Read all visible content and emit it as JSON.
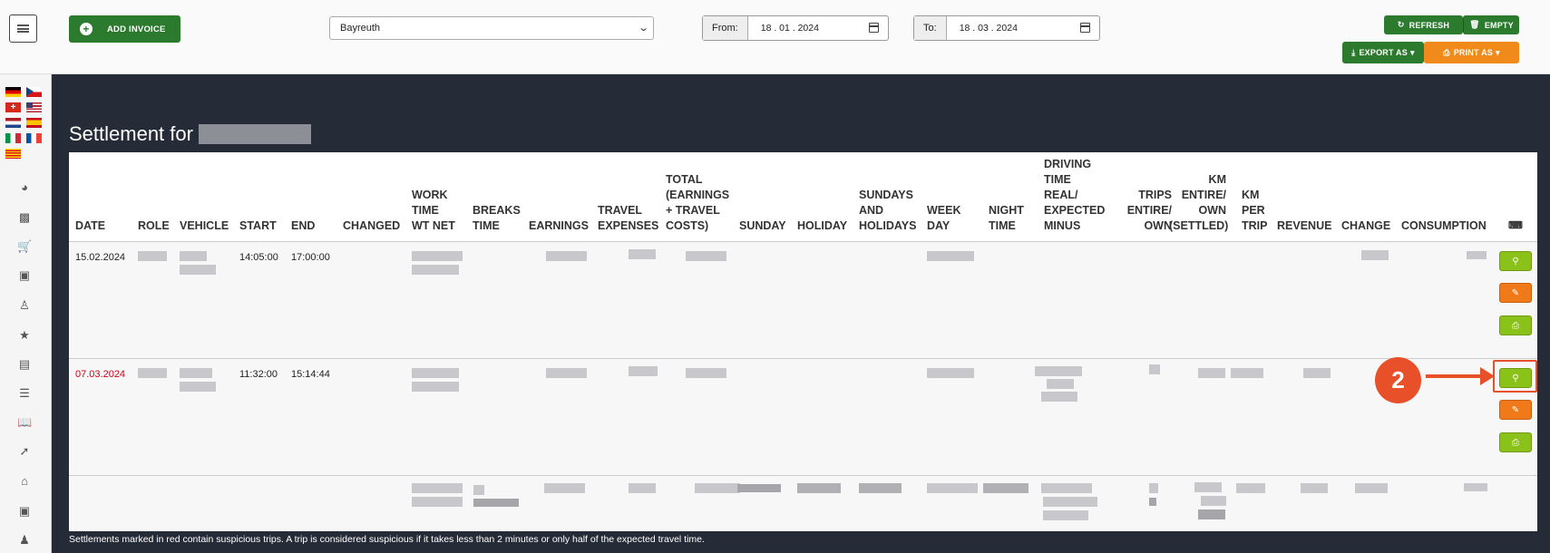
{
  "toolbar": {
    "add_invoice": "ADD INVOICE",
    "location": "Bayreuth",
    "from_label": "From:",
    "from_value": "18 . 01 . 2024",
    "to_label": "To:",
    "to_value": "18 . 03 . 2024",
    "refresh": "REFRESH",
    "empty": "EMPTY",
    "export_as": "EXPORT AS",
    "print_as": "PRINT AS"
  },
  "page": {
    "title": "Settlement for",
    "footer_note": "Settlements marked in red contain suspicious trips. A trip is considered suspicious if it takes less than 2 minutes or only half of the expected travel time."
  },
  "table": {
    "headers": {
      "date": "DATE",
      "role": "ROLE",
      "vehicle": "VEHICLE",
      "start": "START",
      "end": "END",
      "changed": "CHANGED",
      "work_time": "WORK\nTIME\nWT NET",
      "breaks_time": "BREAKS\nTIME",
      "earnings": "EARNINGS",
      "travel_expenses": "TRAVEL\nEXPENSES",
      "total": "TOTAL\n(EARNINGS\n+ TRAVEL\nCOSTS)",
      "sunday": "SUNDAY",
      "holiday": "HOLIDAY",
      "sundays_holidays": "SUNDAYS\nAND\nHOLIDAYS",
      "week_day": "WEEK\nDAY",
      "night_time": "NIGHT\nTIME",
      "driving_time": "DRIVING\nTIME\nREAL/\nEXPECTED\nMINUS",
      "trips": "TRIPS\nENTIRE/\nOWN",
      "km": "KM\nENTIRE/\nOWN\n(SETTLED)",
      "km_per_trip": "KM\nPER\nTRIP",
      "revenue": "REVENUE",
      "change": "CHANGE",
      "consumption": "CONSUMPTION"
    },
    "rows": [
      {
        "date": "15.02.2024",
        "start": "14:05:00",
        "end": "17:00:00",
        "suspicious": false
      },
      {
        "date": "07.03.2024",
        "start": "11:32:00",
        "end": "15:14:44",
        "suspicious": true
      }
    ]
  },
  "annotation": {
    "step": "2"
  },
  "colors": {
    "primary_green": "#2c7a2e",
    "action_green": "#8bc21a",
    "orange": "#f08a1a",
    "suspicious_red": "#d0021b",
    "annotation": "#e8502a"
  }
}
